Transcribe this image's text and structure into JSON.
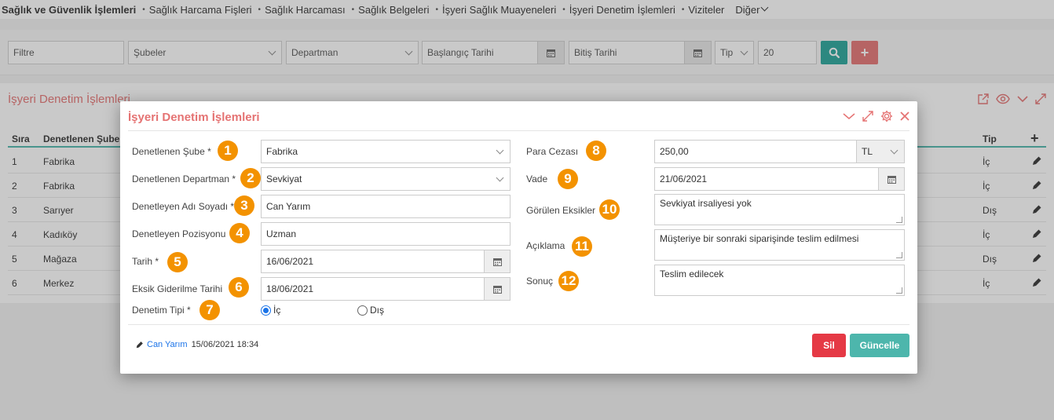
{
  "topnav": {
    "items": [
      "Sağlık ve Güvenlik İşlemleri",
      "Sağlık Harcama Fişleri",
      "Sağlık Harcaması",
      "Sağlık Belgeleri",
      "İşyeri Sağlık Muayeneleri",
      "İşyeri Denetim İşlemleri",
      "Viziteler"
    ],
    "more": "Diğer"
  },
  "filters": {
    "filter_placeholder": "Filtre",
    "branches": "Şubeler",
    "department": "Departman",
    "start_date": "Başlangıç Tarihi",
    "end_date": "Bitiş Tarihi",
    "type": "Tip",
    "count": "20"
  },
  "panel": {
    "title": "İşyeri Denetim İşlemleri",
    "columns": {
      "no": "Sıra",
      "branch": "Denetlenen Şube",
      "type": "Tip"
    },
    "rows": [
      {
        "no": "1",
        "branch": "Fabrika",
        "type": "İç"
      },
      {
        "no": "2",
        "branch": "Fabrika",
        "type": "İç"
      },
      {
        "no": "3",
        "branch": "Sarıyer",
        "type": "Dış"
      },
      {
        "no": "4",
        "branch": "Kadıköy",
        "type": "İç"
      },
      {
        "no": "5",
        "branch": "Mağaza",
        "type": "Dış"
      },
      {
        "no": "6",
        "branch": "Merkez",
        "type": "İç"
      }
    ]
  },
  "modal": {
    "title": "İşyeri Denetim İşlemleri",
    "labels": {
      "branch": "Denetlenen Şube *",
      "department": "Denetlenen Departman *",
      "inspector_name": "Denetleyen Adı Soyadı *",
      "inspector_position": "Denetleyen Pozisyonu",
      "date": "Tarih *",
      "fix_date": "Eksik Giderilme Tarihi",
      "type": "Denetim Tipi *",
      "fine": "Para Cezası",
      "due": "Vade",
      "deficiencies": "Görülen Eksikler",
      "description": "Açıklama",
      "result": "Sonuç"
    },
    "values": {
      "branch": "Fabrika",
      "department": "Sevkiyat",
      "inspector_name": "Can Yarım",
      "inspector_position": "Uzman",
      "date": "16/06/2021",
      "fix_date": "18/06/2021",
      "fine": "250,00",
      "currency": "TL",
      "due": "21/06/2021",
      "deficiencies": "Sevkiyat irsaliyesi yok",
      "description": "Müşteriye bir sonraki siparişinde teslim edilmesi",
      "result": "Teslim edilecek"
    },
    "type_options": {
      "internal": "İç",
      "external": "Dış",
      "selected": "İç"
    },
    "badges": [
      "1",
      "2",
      "3",
      "4",
      "5",
      "6",
      "7",
      "8",
      "9",
      "10",
      "11",
      "12"
    ],
    "footer": {
      "user": "Can Yarım",
      "timestamp": "15/06/2021 18:34",
      "delete": "Sil",
      "update": "Güncelle"
    }
  },
  "colors": {
    "accent_red": "#e57373",
    "teal": "#4db6ac",
    "badge_orange": "#f39200",
    "delete_red": "#e53945",
    "update_teal": "#4db6ac"
  }
}
